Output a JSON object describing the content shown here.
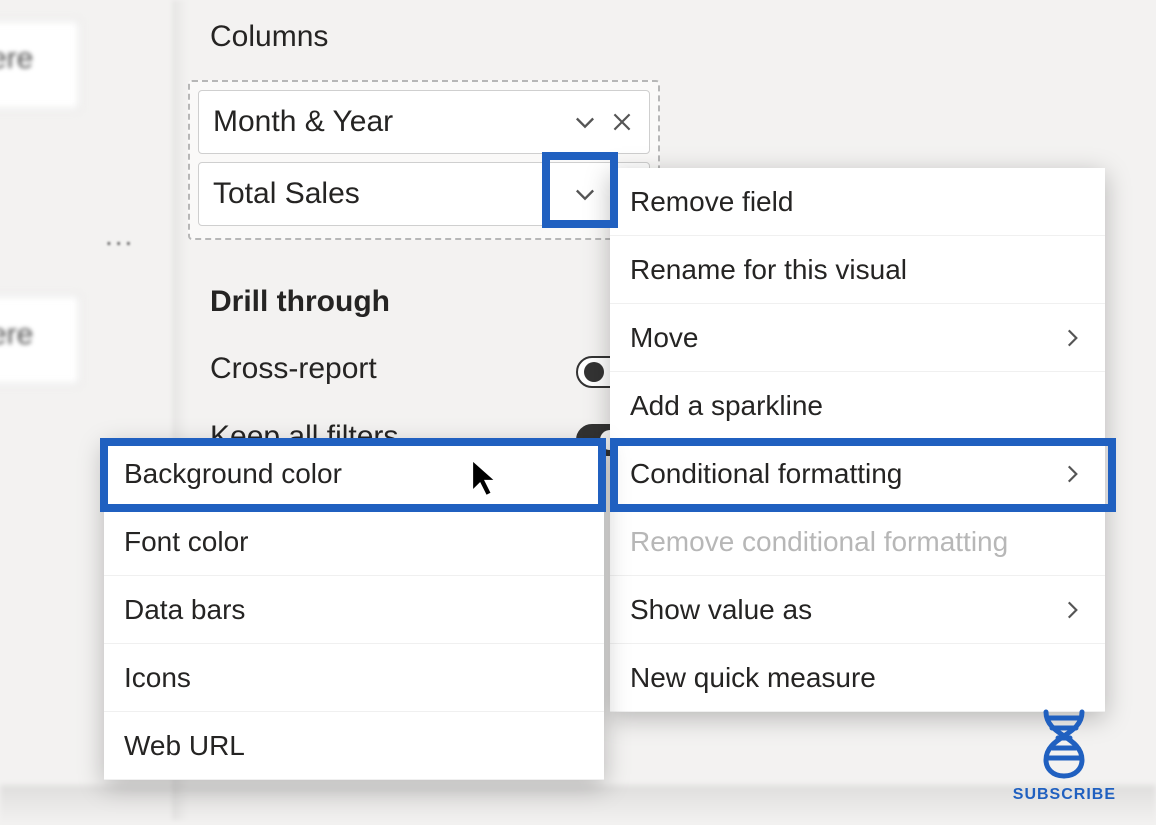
{
  "left_panel": {
    "row_fragment_1": "ere",
    "row_fragment_2": "ere",
    "ellipsis": "..."
  },
  "columns": {
    "label": "Columns",
    "fields": [
      {
        "name": "Month & Year"
      },
      {
        "name": "Total Sales"
      }
    ]
  },
  "drill_through": {
    "label": "Drill through",
    "cross_report": "Cross-report",
    "keep_all_filters": "Keep all filters"
  },
  "context_menu": {
    "items": [
      {
        "label": "Remove field"
      },
      {
        "label": "Rename for this visual"
      },
      {
        "label": "Move",
        "hasSubmenu": true
      },
      {
        "label": "Add a sparkline"
      },
      {
        "label": "Conditional formatting",
        "hasSubmenu": true
      },
      {
        "label": "Remove conditional formatting",
        "disabled": true
      },
      {
        "label": "Show value as",
        "hasSubmenu": true
      },
      {
        "label": "New quick measure"
      }
    ]
  },
  "conditional_formatting_submenu": {
    "items": [
      {
        "label": "Background color"
      },
      {
        "label": "Font color"
      },
      {
        "label": "Data bars"
      },
      {
        "label": "Icons"
      },
      {
        "label": "Web URL"
      }
    ]
  },
  "subscribe": {
    "label": "SUBSCRIBE"
  },
  "highlight_color": "#2060c0"
}
